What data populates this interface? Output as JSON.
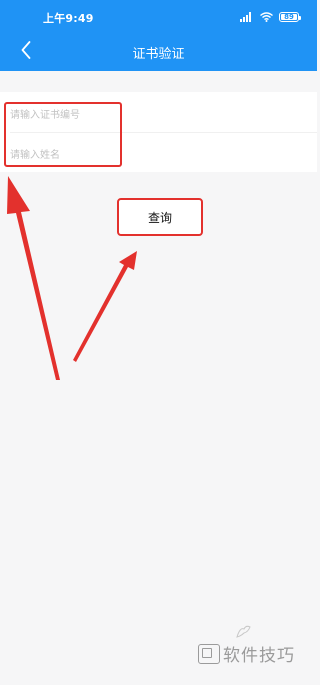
{
  "status_bar": {
    "time": "上午9:49",
    "battery": "89",
    "icons": [
      "signal-icon",
      "wifi-icon",
      "battery-icon"
    ]
  },
  "nav": {
    "back_icon": "chevron-left-icon",
    "title": "证书验证"
  },
  "form": {
    "cert_number_placeholder": "请输入证书编号",
    "name_placeholder": "请输入姓名"
  },
  "actions": {
    "query_label": "查询"
  },
  "watermark": {
    "text": "软件技巧"
  },
  "colors": {
    "header": "#1f93f5",
    "annotation": "#e3312d",
    "page_background": "#f6f6f7"
  }
}
